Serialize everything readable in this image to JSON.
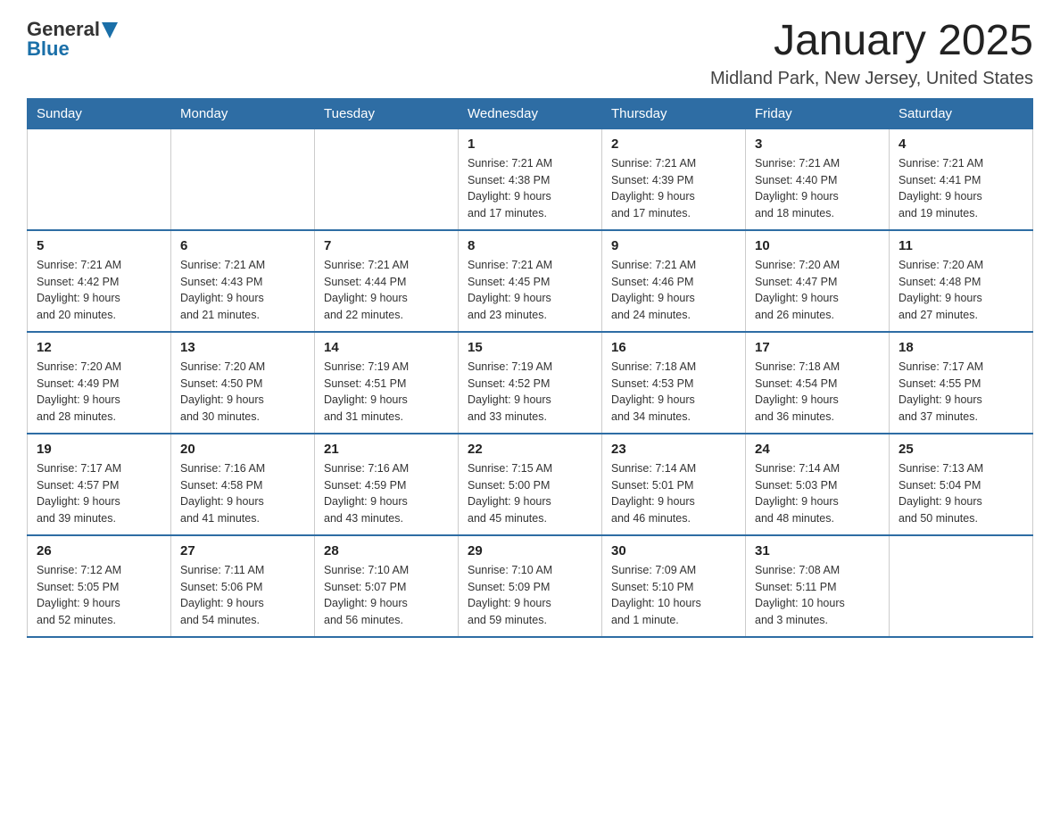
{
  "header": {
    "logo_general": "General",
    "logo_blue": "Blue",
    "title": "January 2025",
    "subtitle": "Midland Park, New Jersey, United States"
  },
  "days_of_week": [
    "Sunday",
    "Monday",
    "Tuesday",
    "Wednesday",
    "Thursday",
    "Friday",
    "Saturday"
  ],
  "weeks": [
    [
      {
        "day": "",
        "info": ""
      },
      {
        "day": "",
        "info": ""
      },
      {
        "day": "",
        "info": ""
      },
      {
        "day": "1",
        "info": "Sunrise: 7:21 AM\nSunset: 4:38 PM\nDaylight: 9 hours\nand 17 minutes."
      },
      {
        "day": "2",
        "info": "Sunrise: 7:21 AM\nSunset: 4:39 PM\nDaylight: 9 hours\nand 17 minutes."
      },
      {
        "day": "3",
        "info": "Sunrise: 7:21 AM\nSunset: 4:40 PM\nDaylight: 9 hours\nand 18 minutes."
      },
      {
        "day": "4",
        "info": "Sunrise: 7:21 AM\nSunset: 4:41 PM\nDaylight: 9 hours\nand 19 minutes."
      }
    ],
    [
      {
        "day": "5",
        "info": "Sunrise: 7:21 AM\nSunset: 4:42 PM\nDaylight: 9 hours\nand 20 minutes."
      },
      {
        "day": "6",
        "info": "Sunrise: 7:21 AM\nSunset: 4:43 PM\nDaylight: 9 hours\nand 21 minutes."
      },
      {
        "day": "7",
        "info": "Sunrise: 7:21 AM\nSunset: 4:44 PM\nDaylight: 9 hours\nand 22 minutes."
      },
      {
        "day": "8",
        "info": "Sunrise: 7:21 AM\nSunset: 4:45 PM\nDaylight: 9 hours\nand 23 minutes."
      },
      {
        "day": "9",
        "info": "Sunrise: 7:21 AM\nSunset: 4:46 PM\nDaylight: 9 hours\nand 24 minutes."
      },
      {
        "day": "10",
        "info": "Sunrise: 7:20 AM\nSunset: 4:47 PM\nDaylight: 9 hours\nand 26 minutes."
      },
      {
        "day": "11",
        "info": "Sunrise: 7:20 AM\nSunset: 4:48 PM\nDaylight: 9 hours\nand 27 minutes."
      }
    ],
    [
      {
        "day": "12",
        "info": "Sunrise: 7:20 AM\nSunset: 4:49 PM\nDaylight: 9 hours\nand 28 minutes."
      },
      {
        "day": "13",
        "info": "Sunrise: 7:20 AM\nSunset: 4:50 PM\nDaylight: 9 hours\nand 30 minutes."
      },
      {
        "day": "14",
        "info": "Sunrise: 7:19 AM\nSunset: 4:51 PM\nDaylight: 9 hours\nand 31 minutes."
      },
      {
        "day": "15",
        "info": "Sunrise: 7:19 AM\nSunset: 4:52 PM\nDaylight: 9 hours\nand 33 minutes."
      },
      {
        "day": "16",
        "info": "Sunrise: 7:18 AM\nSunset: 4:53 PM\nDaylight: 9 hours\nand 34 minutes."
      },
      {
        "day": "17",
        "info": "Sunrise: 7:18 AM\nSunset: 4:54 PM\nDaylight: 9 hours\nand 36 minutes."
      },
      {
        "day": "18",
        "info": "Sunrise: 7:17 AM\nSunset: 4:55 PM\nDaylight: 9 hours\nand 37 minutes."
      }
    ],
    [
      {
        "day": "19",
        "info": "Sunrise: 7:17 AM\nSunset: 4:57 PM\nDaylight: 9 hours\nand 39 minutes."
      },
      {
        "day": "20",
        "info": "Sunrise: 7:16 AM\nSunset: 4:58 PM\nDaylight: 9 hours\nand 41 minutes."
      },
      {
        "day": "21",
        "info": "Sunrise: 7:16 AM\nSunset: 4:59 PM\nDaylight: 9 hours\nand 43 minutes."
      },
      {
        "day": "22",
        "info": "Sunrise: 7:15 AM\nSunset: 5:00 PM\nDaylight: 9 hours\nand 45 minutes."
      },
      {
        "day": "23",
        "info": "Sunrise: 7:14 AM\nSunset: 5:01 PM\nDaylight: 9 hours\nand 46 minutes."
      },
      {
        "day": "24",
        "info": "Sunrise: 7:14 AM\nSunset: 5:03 PM\nDaylight: 9 hours\nand 48 minutes."
      },
      {
        "day": "25",
        "info": "Sunrise: 7:13 AM\nSunset: 5:04 PM\nDaylight: 9 hours\nand 50 minutes."
      }
    ],
    [
      {
        "day": "26",
        "info": "Sunrise: 7:12 AM\nSunset: 5:05 PM\nDaylight: 9 hours\nand 52 minutes."
      },
      {
        "day": "27",
        "info": "Sunrise: 7:11 AM\nSunset: 5:06 PM\nDaylight: 9 hours\nand 54 minutes."
      },
      {
        "day": "28",
        "info": "Sunrise: 7:10 AM\nSunset: 5:07 PM\nDaylight: 9 hours\nand 56 minutes."
      },
      {
        "day": "29",
        "info": "Sunrise: 7:10 AM\nSunset: 5:09 PM\nDaylight: 9 hours\nand 59 minutes."
      },
      {
        "day": "30",
        "info": "Sunrise: 7:09 AM\nSunset: 5:10 PM\nDaylight: 10 hours\nand 1 minute."
      },
      {
        "day": "31",
        "info": "Sunrise: 7:08 AM\nSunset: 5:11 PM\nDaylight: 10 hours\nand 3 minutes."
      },
      {
        "day": "",
        "info": ""
      }
    ]
  ]
}
